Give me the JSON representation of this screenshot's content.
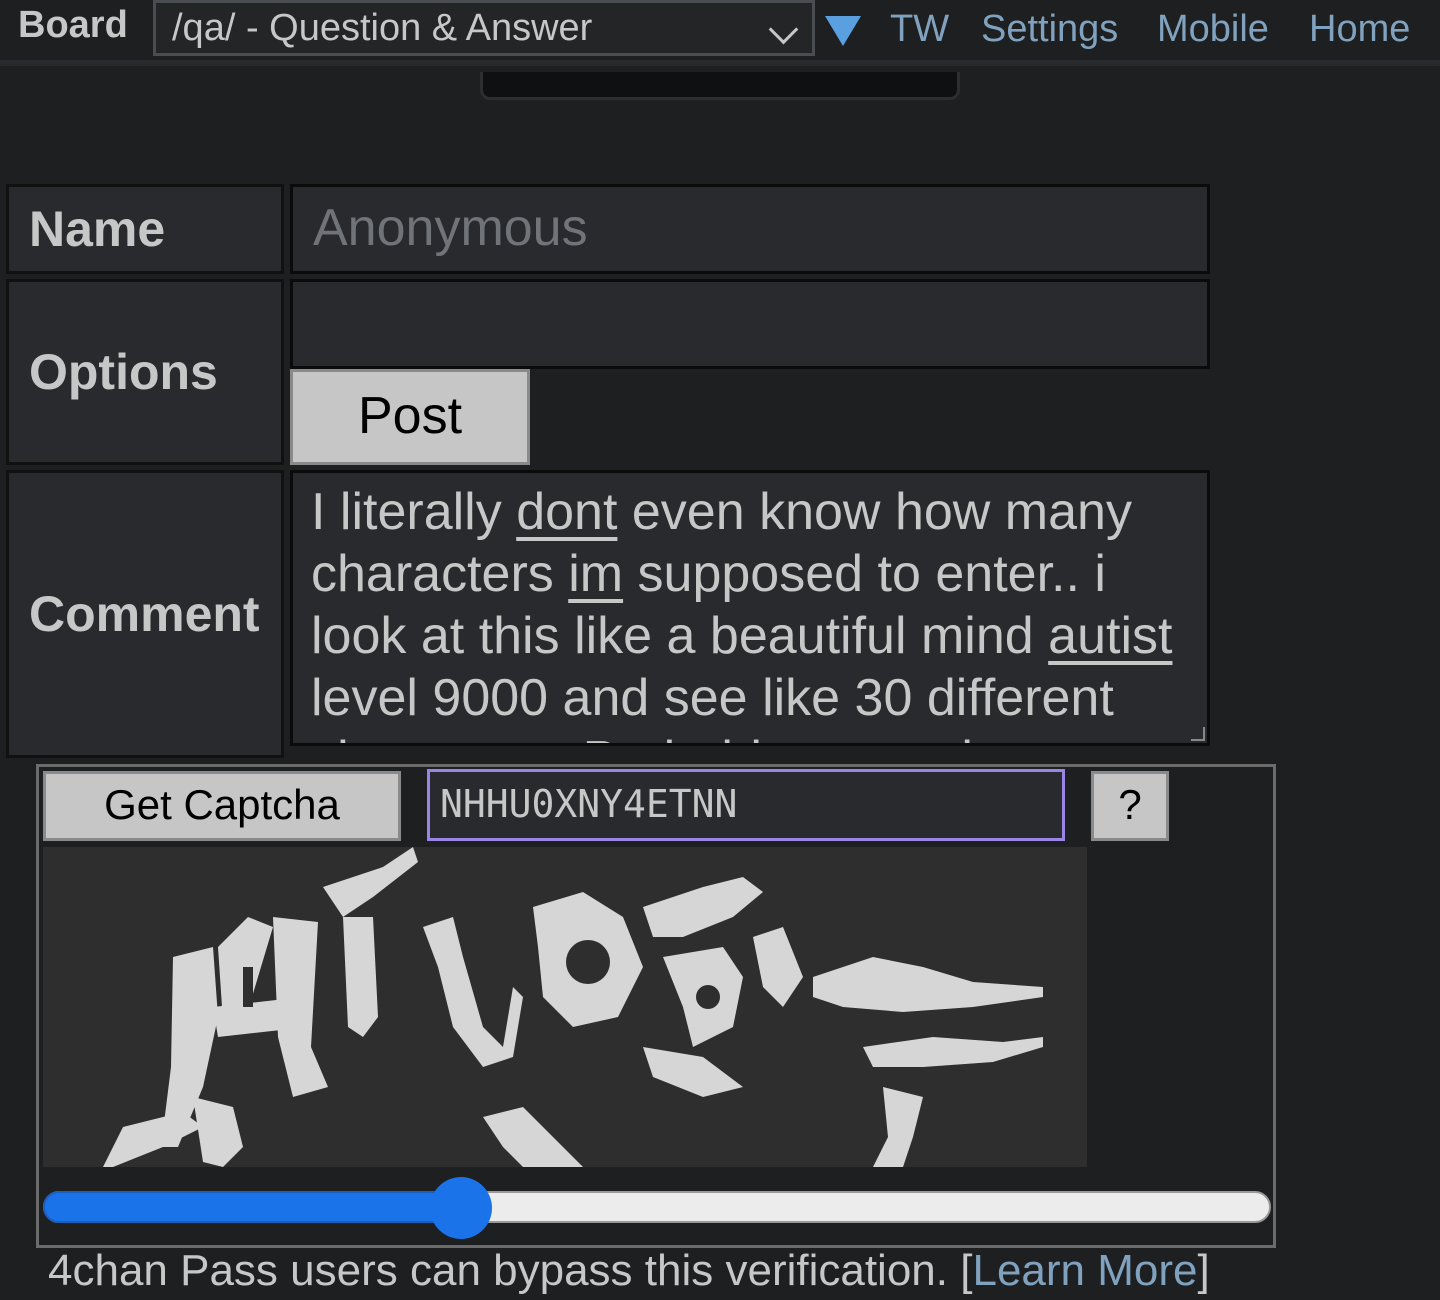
{
  "topbar": {
    "board_label": "Board",
    "board_selected": "/qa/ - Question & Answer",
    "links": [
      "TW",
      "Settings",
      "Mobile",
      "Home"
    ]
  },
  "form": {
    "name_label": "Name",
    "name_placeholder": "Anonymous",
    "options_label": "Options",
    "options_value": "",
    "post_label": "Post",
    "comment_label": "Comment",
    "comment_text": "I literally dont even know how many characters im supposed to enter.. i look at this like a beautiful mind autist level 9000 and see like 30 different characters. Probably gonna be honest"
  },
  "captcha": {
    "get_label": "Get Captcha",
    "input_value": "NHHU0XNY4ETNN",
    "help_label": "?",
    "slider_value": 0.34
  },
  "pass_note": {
    "text": "4chan Pass users can bypass this verification. ",
    "bracket_open": "[",
    "link_text": "Learn More",
    "bracket_close": "]"
  },
  "colors": {
    "background": "#1d1f21",
    "link": "#81a2be",
    "slider_accent": "#1a73e8",
    "captcha_focus": "#9a85e6"
  }
}
